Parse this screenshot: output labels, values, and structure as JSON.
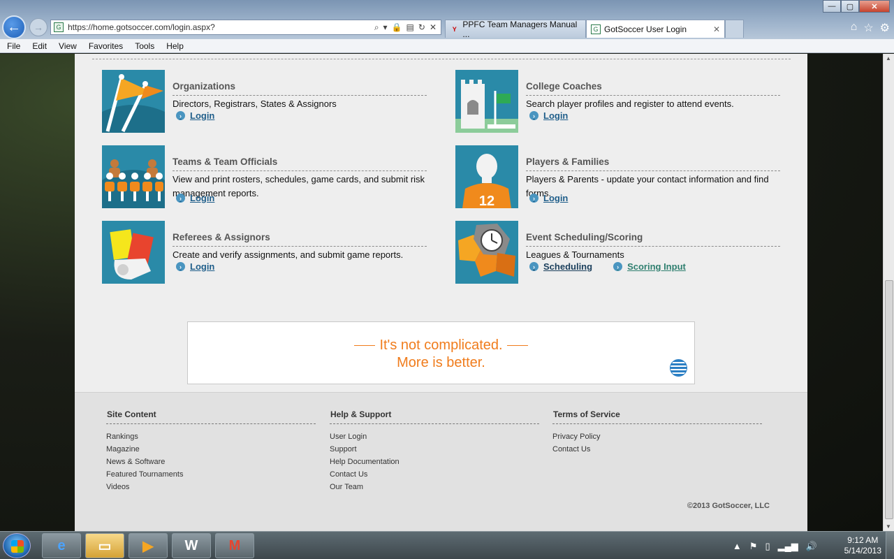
{
  "browser": {
    "url": "https://home.gotsoccer.com/login.aspx?",
    "tabs": [
      {
        "label": "PPFC Team Managers Manual ...",
        "active": false
      },
      {
        "label": "GotSoccer User Login",
        "active": true
      }
    ],
    "menu": [
      "File",
      "Edit",
      "View",
      "Favorites",
      "Tools",
      "Help"
    ],
    "window_controls": {
      "minimize": "—",
      "maximize": "▢",
      "close": "✕"
    }
  },
  "page": {
    "cards": [
      {
        "title": "Organizations",
        "desc": "Directors, Registrars, States & Assignors",
        "links": [
          "Login"
        ]
      },
      {
        "title": "College Coaches",
        "desc": "Search player profiles and register to attend events.",
        "links": [
          "Login"
        ]
      },
      {
        "title": "Teams & Team Officials",
        "desc": "View and print rosters, schedules, game cards, and submit risk management reports.",
        "links": [
          "Login"
        ]
      },
      {
        "title": "Players & Families",
        "desc": "Players & Parents - update your contact information and find forms.",
        "links": [
          "Login"
        ]
      },
      {
        "title": "Referees & Assignors",
        "desc": "Create and verify assignments, and submit game reports.",
        "links": [
          "Login"
        ]
      },
      {
        "title": "Event Scheduling/Scoring",
        "desc": "Leagues & Tournaments",
        "links": [
          "Scheduling",
          "Scoring Input"
        ]
      }
    ],
    "player_number": "12",
    "ad": {
      "line1": "It's not complicated.",
      "line2": "More is better."
    }
  },
  "footer": {
    "columns": [
      {
        "heading": "Site Content",
        "items": [
          "Rankings",
          "Magazine",
          "News & Software",
          "Featured Tournaments",
          "Videos"
        ]
      },
      {
        "heading": "Help & Support",
        "items": [
          "User Login",
          "Support",
          "Help Documentation",
          "Contact Us",
          "Our Team"
        ]
      },
      {
        "heading": "Terms of Service",
        "items": [
          "Privacy Policy",
          "Contact Us"
        ]
      }
    ],
    "copyright": "©2013 GotSoccer, LLC"
  },
  "taskbar": {
    "time": "9:12 AM",
    "date": "5/14/2013"
  },
  "colors": {
    "link": "#1f5e8a",
    "accent_orange": "#f07c1c",
    "thumb_teal": "#2a8aa8"
  }
}
